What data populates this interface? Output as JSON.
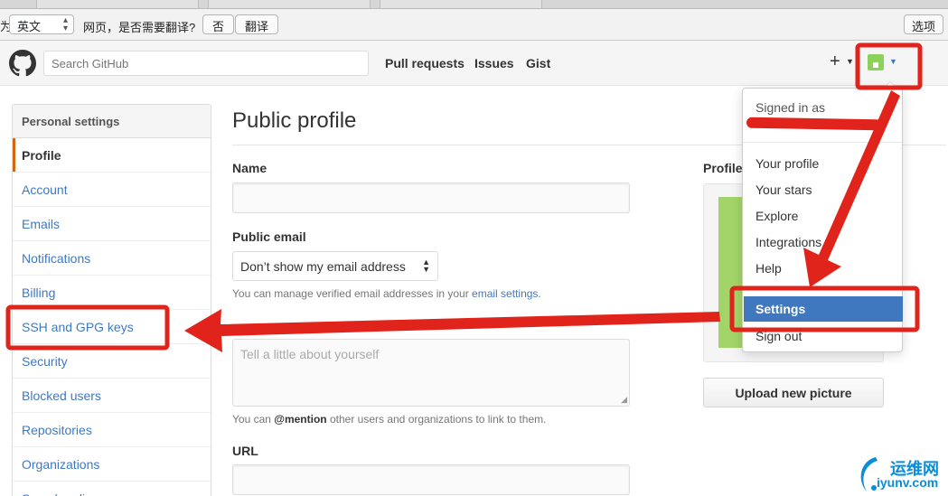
{
  "translate_bar": {
    "cut_text": "为",
    "language": "英文",
    "question": "网页，是否需要翻译?",
    "no_label": "否",
    "translate_label": "翻译",
    "options_label": "选项"
  },
  "header": {
    "search_placeholder": "Search GitHub",
    "nav": [
      "Pull requests",
      "Issues",
      "Gist"
    ],
    "plus_label": "+"
  },
  "sidebar": {
    "heading": "Personal settings",
    "items": [
      {
        "label": "Profile",
        "selected": true
      },
      {
        "label": "Account"
      },
      {
        "label": "Emails"
      },
      {
        "label": "Notifications"
      },
      {
        "label": "Billing"
      },
      {
        "label": "SSH and GPG keys"
      },
      {
        "label": "Security"
      },
      {
        "label": "Blocked users"
      },
      {
        "label": "Repositories"
      },
      {
        "label": "Organizations"
      },
      {
        "label": "Saved replies"
      }
    ]
  },
  "main": {
    "title": "Public profile",
    "name_label": "Name",
    "email_label": "Public email",
    "email_select": "Don’t show my email address",
    "email_note_prefix": "You can manage verified email addresses in your ",
    "email_note_link": "email settings",
    "email_note_suffix": ".",
    "bio_placeholder": "Tell a little about yourself",
    "bio_note_prefix": "You can ",
    "bio_note_mention": "@mention",
    "bio_note_suffix": " other users and organizations to link to them.",
    "url_label": "URL",
    "picture_label": "Profile picture",
    "upload_label": "Upload new picture"
  },
  "dropdown": {
    "signed_in": "Signed in as",
    "items": [
      "Your profile",
      "Your stars",
      "Explore",
      "Integrations",
      "Help"
    ],
    "settings": "Settings",
    "sign_out": "Sign out"
  },
  "watermark": {
    "cn": "运维网",
    "en": "iyunv.com"
  },
  "colors": {
    "link": "#4078c0",
    "selected_bar": "#d26911",
    "annotation": "#e0241b",
    "avatar": "#8cd25a"
  }
}
